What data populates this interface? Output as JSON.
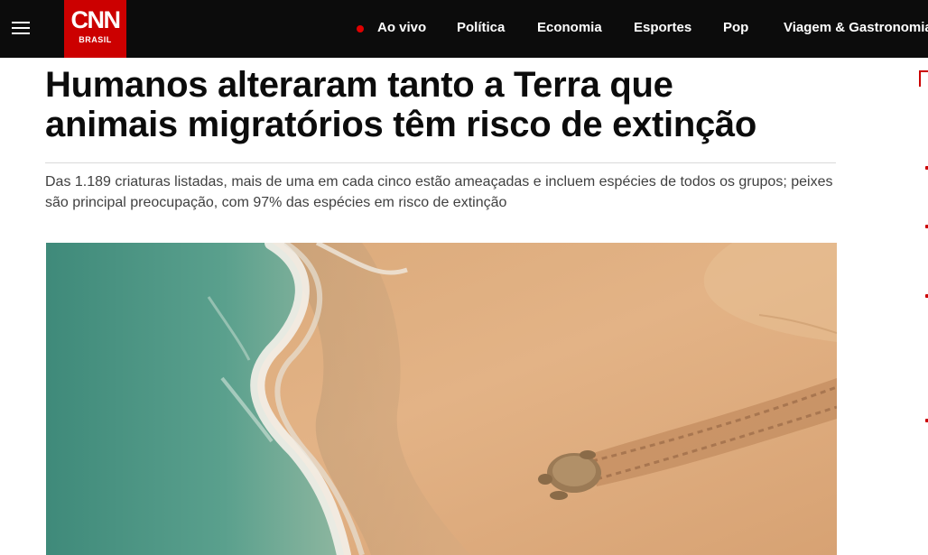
{
  "header": {
    "logo_text": "CNN",
    "logo_sub": "BRASIL",
    "nav": [
      {
        "label": "Ao vivo"
      },
      {
        "label": "Política"
      },
      {
        "label": "Economia"
      },
      {
        "label": "Esportes"
      },
      {
        "label": "Pop"
      },
      {
        "label": "Viagem & Gastronomia"
      }
    ]
  },
  "article": {
    "headline_line1": "Humanos alteraram tanto a Terra que",
    "headline_line2": "animais migratórios têm risco de extinção",
    "lede": "Das 1.189 criaturas listadas, mais de uma em cada cinco estão ameaçadas e incluem espécies de todos os grupos; peixes são principal preocupação, com 97% das espécies em risco de extinção"
  },
  "colors": {
    "brand_red": "#cc0000",
    "topbar": "#0c0c0c",
    "live_dot": "#e00000"
  }
}
